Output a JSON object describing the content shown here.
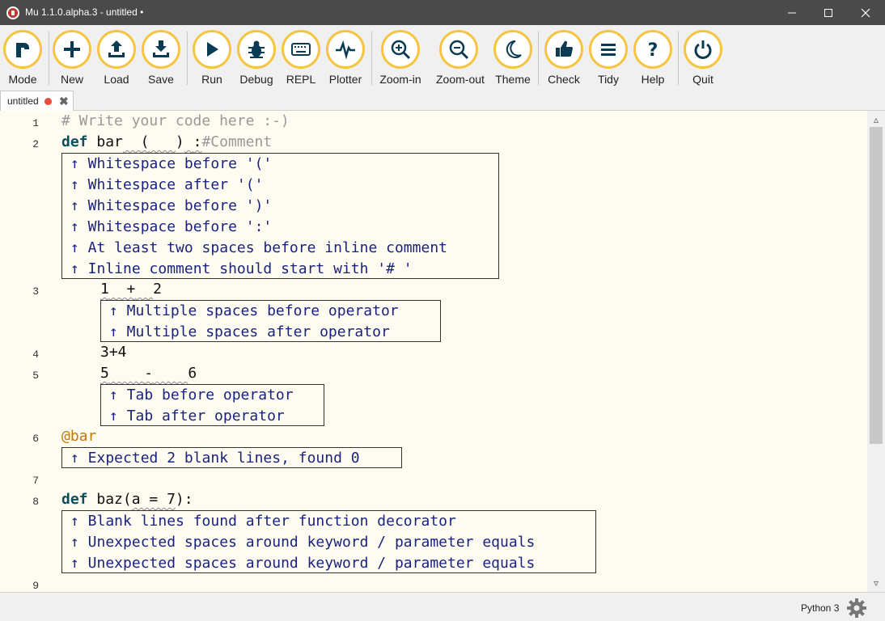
{
  "window": {
    "title": "Mu 1.1.0.alpha.3 - untitled •"
  },
  "toolbar": [
    {
      "id": "mode",
      "label": "Mode",
      "icon": "mode-icon"
    },
    {
      "id": "new",
      "label": "New",
      "icon": "plus-icon"
    },
    {
      "id": "load",
      "label": "Load",
      "icon": "upload-icon"
    },
    {
      "id": "save",
      "label": "Save",
      "icon": "download-icon"
    },
    {
      "id": "run",
      "label": "Run",
      "icon": "play-icon"
    },
    {
      "id": "debug",
      "label": "Debug",
      "icon": "bug-icon"
    },
    {
      "id": "repl",
      "label": "REPL",
      "icon": "keyboard-icon"
    },
    {
      "id": "plotter",
      "label": "Plotter",
      "icon": "pulse-icon"
    },
    {
      "id": "zoom-in",
      "label": "Zoom-in",
      "icon": "zoom-in-icon"
    },
    {
      "id": "zoom-out",
      "label": "Zoom-out",
      "icon": "zoom-out-icon"
    },
    {
      "id": "theme",
      "label": "Theme",
      "icon": "moon-icon"
    },
    {
      "id": "check",
      "label": "Check",
      "icon": "thumbs-up-icon"
    },
    {
      "id": "tidy",
      "label": "Tidy",
      "icon": "lines-icon"
    },
    {
      "id": "help",
      "label": "Help",
      "icon": "question-icon"
    },
    {
      "id": "quit",
      "label": "Quit",
      "icon": "power-icon"
    }
  ],
  "tab": {
    "label": "untitled",
    "modified": true
  },
  "editor": {
    "line_numbers": [
      "1",
      "2",
      "3",
      "4",
      "5",
      "6",
      "7",
      "8",
      "9"
    ],
    "code": {
      "l1": "# Write your code here :-)",
      "l2_kw": "def",
      "l2_name": "bar",
      "l2_gap1": "  ",
      "l2_paren_open": "(",
      "l2_gap2": "   ",
      "l2_paren_close": ")",
      "l2_gap3": " ",
      "l2_colon": ":",
      "l2_comment": "#Comment",
      "l3_a": "1",
      "l3_gap1": "  ",
      "l3_op": "+",
      "l3_gap2": "  ",
      "l3_b": "2",
      "l4": "3+4",
      "l5_a": "5",
      "l5_gap1": "    ",
      "l5_op": "-",
      "l5_gap2": "    ",
      "l5_b": "6",
      "l6": "@bar",
      "l8_kw": "def",
      "l8_name": "baz(",
      "l8_param": "a = 7",
      "l8_end": "):"
    },
    "notes": {
      "n2": [
        "↑ Whitespace before '('",
        "↑ Whitespace after '('",
        "↑ Whitespace before ')'",
        "↑ Whitespace before ':'",
        "↑ At least two spaces before inline comment",
        "↑ Inline comment should start with '# '"
      ],
      "n3": [
        "↑ Multiple spaces before operator",
        "↑ Multiple spaces after operator"
      ],
      "n5": [
        "↑ Tab before operator",
        "↑ Tab after operator"
      ],
      "n6": [
        "↑ Expected 2 blank lines, found 0"
      ],
      "n8": [
        "↑ Blank lines found after function decorator",
        "↑ Unexpected spaces around keyword / parameter equals",
        "↑ Unexpected spaces around keyword / parameter equals"
      ]
    }
  },
  "status": {
    "mode": "Python 3"
  },
  "colors": {
    "accent": "#f5c542",
    "title_bar": "#4a4a4a",
    "editor_bg": "#fefbf0",
    "note_text": "#1a237e"
  }
}
